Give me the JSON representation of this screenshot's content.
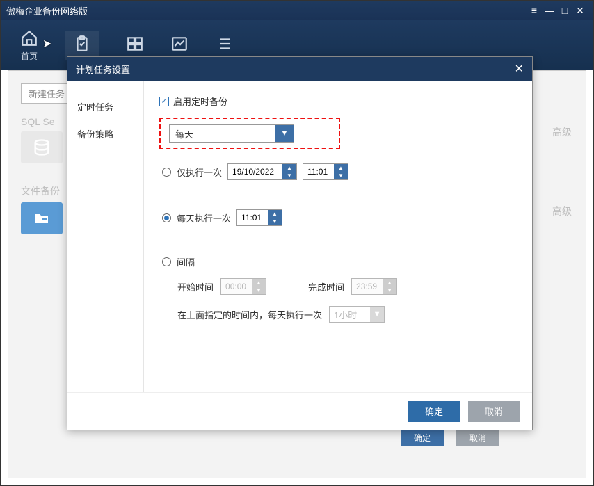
{
  "app": {
    "title": "傲梅企业备份网络版"
  },
  "titlebar_icons": {
    "list": "≡",
    "min": "—",
    "max": "□",
    "close": "✕"
  },
  "nav": {
    "home": "首页",
    "tabs_aria": {
      "home": "home",
      "tasks": "tasks",
      "system": "system",
      "monitor": "monitor",
      "logs": "logs"
    }
  },
  "background": {
    "new_task": "新建任务",
    "sql_label": "SQL Se",
    "file_label": "文件备份",
    "advanced": "高级",
    "confirm": "确定",
    "cancel": "取消"
  },
  "modal": {
    "title": "计划任务设置",
    "close_symbol": "✕",
    "sidebar": {
      "items": [
        {
          "label": "定时任务",
          "active": true
        },
        {
          "label": "备份策略",
          "active": false
        }
      ]
    },
    "enable_checkbox": "启用定时备份",
    "enable_checked": true,
    "frequency_select": {
      "value": "每天"
    },
    "once": {
      "label": "仅执行一次",
      "date": "19/10/2022",
      "time": "11:01"
    },
    "daily": {
      "label": "每天执行一次",
      "time": "11:01"
    },
    "interval": {
      "label": "间隔",
      "start_label": "开始时间",
      "start": "00:00",
      "end_label": "完成时间",
      "end": "23:59",
      "repeat_prefix": "在上面指定的时间内，每天执行一次",
      "repeat_value": "1小时"
    },
    "footer": {
      "ok": "确定",
      "cancel": "取消"
    }
  }
}
